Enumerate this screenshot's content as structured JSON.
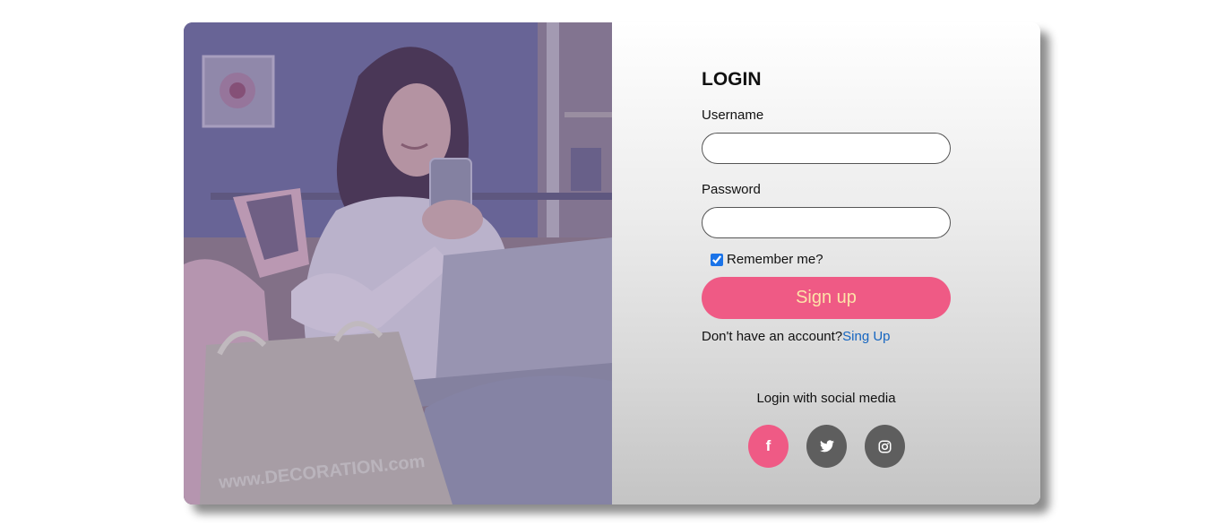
{
  "login": {
    "title": "LOGIN",
    "username_label": "Username",
    "username_value": "",
    "password_label": "Password",
    "password_value": "",
    "remember_label": "Remember me?",
    "remember_checked": true,
    "signup_button": "Sign up",
    "no_account_text": "Don't have an account?",
    "no_account_link": "Sing Up",
    "social_title": "Login with social media"
  },
  "social": {
    "facebook_icon": "f",
    "twitter_icon": "twitter-icon",
    "instagram_icon": "instagram-icon"
  },
  "photo": {
    "bag_text": "www.DECORATION.com"
  },
  "colors": {
    "accent": "#ef5a85",
    "social_dark": "#5e5e5e",
    "link": "#1565c0",
    "button_text": "#fde3a8"
  }
}
